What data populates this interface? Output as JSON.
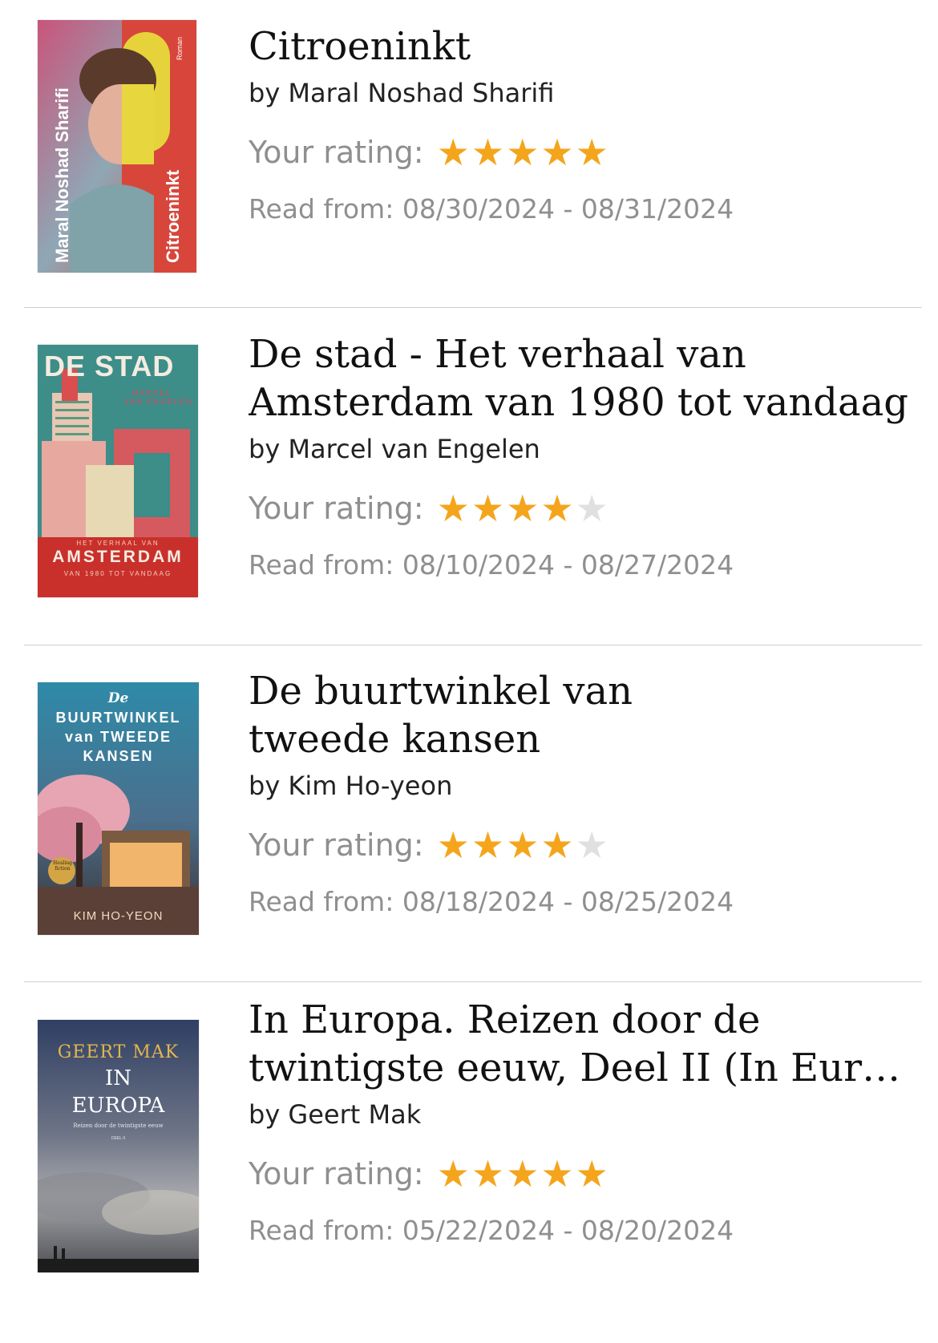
{
  "labels": {
    "rating": "Your rating:",
    "read_from": "Read from:"
  },
  "colors": {
    "star_on": "#f4a51c",
    "star_off": "#e0e0e0"
  },
  "books": [
    {
      "title": "Citroeninkt",
      "author": "by Maral Noshad Sharifi",
      "rating": 5,
      "read_from": "08/30/2024 - 08/31/2024",
      "cover": {
        "author": "Maral Noshad Sharifi",
        "title": "Citroeninkt",
        "tag": "Roman"
      }
    },
    {
      "title": "De stad - Het verhaal van Amsterdam van 1980 tot vandaag",
      "title_lines": [
        "De stad - Het verhaal van",
        "Amsterdam van 1980 tot vandaag"
      ],
      "author": "by Marcel van Engelen",
      "rating": 4,
      "read_from": "08/10/2024 - 08/27/2024",
      "cover": {
        "title": "DE STAD",
        "author1": "MARCEL",
        "author2": "VAN ENGELEN",
        "sub1": "HET VERHAAL VAN",
        "city": "AMSTERDAM",
        "sub2": "VAN 1980 TOT VANDAAG"
      }
    },
    {
      "title": "De buurtwinkel van tweede kansen",
      "title_lines": [
        "De buurtwinkel van",
        "tweede kansen"
      ],
      "author": "by Kim Ho-yeon",
      "rating": 4,
      "read_from": "08/18/2024 - 08/25/2024",
      "cover": {
        "l1": "De",
        "l2": "BUURTWINKEL",
        "l3": "van TWEEDE",
        "l4": "KANSEN",
        "badge": "Healing fiction",
        "author": "KIM HO-YEON"
      }
    },
    {
      "title": "In Europa. Reizen door de twintigste eeuw, Deel II (In Euro...",
      "title_lines": [
        "In Europa. Reizen door de",
        "twintigste eeuw, Deel II (In Euro…"
      ],
      "author": "by Geert Mak",
      "rating": 5,
      "read_from": "05/22/2024 - 08/20/2024",
      "cover": {
        "author": "GEERT MAK",
        "t1": "IN",
        "t2": "EUROPA",
        "sub": "Reizen door de twintigste eeuw",
        "vol": "DEEL II"
      }
    }
  ]
}
